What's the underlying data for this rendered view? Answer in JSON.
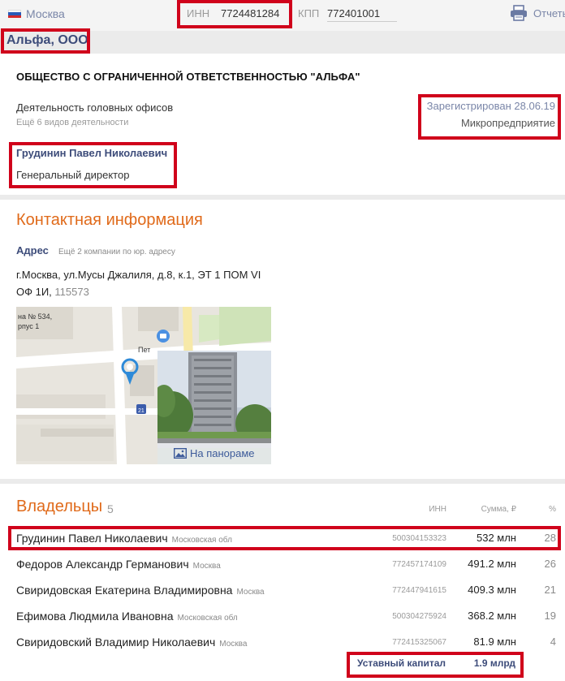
{
  "header": {
    "city": "Москва",
    "inn_label": "ИНН",
    "inn_value": "7724481284",
    "kpp_label": "КПП",
    "kpp_value": "772401001",
    "report_label": "Отчеты"
  },
  "company": {
    "short_name": "Альфа, ООО",
    "full_name": "ОБЩЕСТВО С ОГРАНИЧЕННОЙ ОТВЕТСТВЕННОСТЬЮ \"АЛЬФА\"",
    "activity": "Деятельность головных офисов",
    "more_activities": "Ещё 6 видов деятельности",
    "registered": "Зарегистрирован 28.06.19",
    "size": "Микропредприятие",
    "director_name": "Грудинин Павел Николаевич",
    "director_role": "Генеральный директор"
  },
  "contacts": {
    "title": "Контактная информация",
    "address_label": "Адрес",
    "address_more": "Ещё 2 компании по юр. адресу",
    "address_text": "г.Москва, ул.Мусы Джалиля, д.8, к.1, ЭТ 1 ПОМ VI ОФ 1И,",
    "zip": "115573",
    "map_labels": [
      "на № 534,",
      "рпус 1",
      "Пет",
      "21"
    ],
    "panorama_label": "На панораме"
  },
  "owners": {
    "title": "Владельцы",
    "count": "5",
    "col_inn": "ИНН",
    "col_sum": "Сумма, ₽",
    "col_pct": "%",
    "rows": [
      {
        "name": "Грудинин Павел Николаевич",
        "region": "Московская обл",
        "inn": "500304153323",
        "sum": "532 млн",
        "pct": "28"
      },
      {
        "name": "Федоров Александр Германович",
        "region": "Москва",
        "inn": "772457174109",
        "sum": "491.2 млн",
        "pct": "26"
      },
      {
        "name": "Свиридовская Екатерина Владимировна",
        "region": "Москва",
        "inn": "772447941615",
        "sum": "409.3 млн",
        "pct": "21"
      },
      {
        "name": "Ефимова Людмила Ивановна",
        "region": "Московская обл",
        "inn": "500304275924",
        "sum": "368.2 млн",
        "pct": "19"
      },
      {
        "name": "Свиридовский Владимир Николаевич",
        "region": "Москва",
        "inn": "772415325067",
        "sum": "81.9 млн",
        "pct": "4"
      }
    ],
    "capital_label": "Уставный капитал",
    "capital_value": "1.9 млрд"
  },
  "colors": {
    "accent": "#e06a1a",
    "link": "#3d4c7a",
    "highlight": "#d0021b"
  }
}
